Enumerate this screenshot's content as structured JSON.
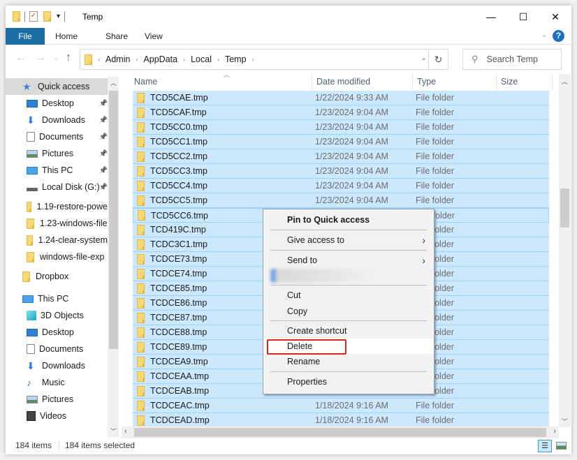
{
  "window": {
    "title": "Temp",
    "controls": {
      "minimize": "—",
      "maximize": "☐",
      "close": "✕"
    }
  },
  "ribbon": {
    "tabs": [
      "File",
      "Home",
      "Share",
      "View"
    ],
    "help": "?"
  },
  "nav": {
    "back": "←",
    "forward": "→",
    "recent": "⌄",
    "up": "↑",
    "breadcrumb": [
      "Admin",
      "AppData",
      "Local",
      "Temp"
    ],
    "refresh": "↻",
    "search_placeholder": "Search Temp"
  },
  "sidebar": {
    "items": [
      {
        "label": "Quick access",
        "icon": "star-icon",
        "level": 0,
        "selected": true
      },
      {
        "label": "Desktop",
        "icon": "desktop-icon",
        "level": 1,
        "pinned": true
      },
      {
        "label": "Downloads",
        "icon": "download-icon",
        "level": 1,
        "pinned": true
      },
      {
        "label": "Documents",
        "icon": "document-icon",
        "level": 1,
        "pinned": true
      },
      {
        "label": "Pictures",
        "icon": "pictures-icon",
        "level": 1,
        "pinned": true
      },
      {
        "label": "This PC",
        "icon": "computer-icon",
        "level": 1,
        "pinned": true
      },
      {
        "label": "Local Disk (G:)",
        "icon": "drive-icon",
        "level": 1,
        "pinned": true
      },
      {
        "label": "1.19-restore-powe",
        "icon": "folder-icon",
        "level": 1
      },
      {
        "label": "1.23-windows-file",
        "icon": "folder-icon",
        "level": 1
      },
      {
        "label": "1.24-clear-system",
        "icon": "folder-icon",
        "level": 1
      },
      {
        "label": "windows-file-exp",
        "icon": "folder-icon",
        "level": 1
      },
      {
        "label": "Dropbox",
        "icon": "folder-icon",
        "level": 0
      },
      {
        "label": "This PC",
        "icon": "computer-icon",
        "level": 0
      },
      {
        "label": "3D Objects",
        "icon": "cube-icon",
        "level": 1
      },
      {
        "label": "Desktop",
        "icon": "desktop-icon",
        "level": 1
      },
      {
        "label": "Documents",
        "icon": "document-icon",
        "level": 1
      },
      {
        "label": "Downloads",
        "icon": "download-icon",
        "level": 1
      },
      {
        "label": "Music",
        "icon": "music-icon",
        "level": 1
      },
      {
        "label": "Pictures",
        "icon": "pictures-icon",
        "level": 1
      },
      {
        "label": "Videos",
        "icon": "video-icon",
        "level": 1
      }
    ]
  },
  "columns": [
    "Name",
    "Date modified",
    "Type",
    "Size"
  ],
  "files": [
    {
      "name": "TCD5CAE.tmp",
      "date": "1/22/2024 9:33 AM",
      "type": "File folder"
    },
    {
      "name": "TCD5CAF.tmp",
      "date": "1/23/2024 9:04 AM",
      "type": "File folder"
    },
    {
      "name": "TCD5CC0.tmp",
      "date": "1/23/2024 9:04 AM",
      "type": "File folder"
    },
    {
      "name": "TCD5CC1.tmp",
      "date": "1/23/2024 9:04 AM",
      "type": "File folder"
    },
    {
      "name": "TCD5CC2.tmp",
      "date": "1/23/2024 9:04 AM",
      "type": "File folder"
    },
    {
      "name": "TCD5CC3.tmp",
      "date": "1/23/2024 9:04 AM",
      "type": "File folder"
    },
    {
      "name": "TCD5CC4.tmp",
      "date": "1/23/2024 9:04 AM",
      "type": "File folder"
    },
    {
      "name": "TCD5CC5.tmp",
      "date": "1/23/2024 9:04 AM",
      "type": "File folder"
    },
    {
      "name": "TCD5CC6.tmp",
      "date": "",
      "type": "File folder"
    },
    {
      "name": "TCD419C.tmp",
      "date": "",
      "type": "File folder"
    },
    {
      "name": "TCDC3C1.tmp",
      "date": "",
      "type": "File folder"
    },
    {
      "name": "TCDCE73.tmp",
      "date": "",
      "type": "File folder"
    },
    {
      "name": "TCDCE74.tmp",
      "date": "",
      "type": "File folder"
    },
    {
      "name": "TCDCE85.tmp",
      "date": "",
      "type": "File folder"
    },
    {
      "name": "TCDCE86.tmp",
      "date": "",
      "type": "File folder"
    },
    {
      "name": "TCDCE87.tmp",
      "date": "",
      "type": "File folder"
    },
    {
      "name": "TCDCE88.tmp",
      "date": "",
      "type": "File folder"
    },
    {
      "name": "TCDCE89.tmp",
      "date": "",
      "type": "File folder"
    },
    {
      "name": "TCDCEA9.tmp",
      "date": "",
      "type": "File folder"
    },
    {
      "name": "TCDCEAA.tmp",
      "date": "",
      "type": "File folder"
    },
    {
      "name": "TCDCEAB.tmp",
      "date": "",
      "type": "File folder"
    },
    {
      "name": "TCDCEAC.tmp",
      "date": "1/18/2024 9:16 AM",
      "type": "File folder"
    },
    {
      "name": "TCDCEAD.tmp",
      "date": "1/18/2024 9:16 AM",
      "type": "File folder"
    }
  ],
  "context_menu": {
    "items": [
      {
        "label": "Pin to Quick access",
        "bold": true
      },
      {
        "label": "Give access to",
        "submenu": true
      },
      {
        "label": "Send to",
        "submenu": true
      },
      {
        "label": "Cut"
      },
      {
        "label": "Copy"
      },
      {
        "label": "Create shortcut"
      },
      {
        "label": "Delete",
        "highlighted": true
      },
      {
        "label": "Rename"
      },
      {
        "label": "Properties"
      }
    ]
  },
  "status": {
    "item_count": "184 items",
    "selected_count": "184 items selected"
  },
  "colors": {
    "file_tab": "#1c6ea4",
    "selection": "#cce8ff",
    "selection_border": "#99d1ff",
    "annotation_red": "#e2231a"
  }
}
